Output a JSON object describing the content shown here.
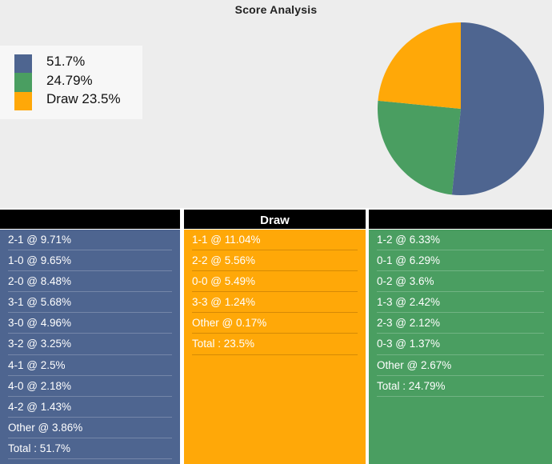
{
  "chart": {
    "title": "Score Analysis"
  },
  "legend": {
    "items": [
      {
        "label": "51.7%",
        "color": "#4e6590"
      },
      {
        "label": "24.79%",
        "color": "#4a9e61"
      },
      {
        "label": "Draw 23.5%",
        "color": "#ffa808"
      }
    ]
  },
  "tables": {
    "home": {
      "header": "",
      "rows": [
        "2-1 @ 9.71%",
        "1-0 @ 9.65%",
        "2-0 @ 8.48%",
        "3-1 @ 5.68%",
        "3-0 @ 4.96%",
        "3-2 @ 3.25%",
        "4-1 @ 2.5%",
        "4-0 @ 2.18%",
        "4-2 @ 1.43%",
        "Other @ 3.86%",
        "Total : 51.7%"
      ]
    },
    "draw": {
      "header": "Draw",
      "rows": [
        "1-1 @ 11.04%",
        "2-2 @ 5.56%",
        "0-0 @ 5.49%",
        "3-3 @ 1.24%",
        "Other @ 0.17%",
        "Total : 23.5%"
      ]
    },
    "away": {
      "header": "",
      "rows": [
        "1-2 @ 6.33%",
        "0-1 @ 6.29%",
        "0-2 @ 3.6%",
        "1-3 @ 2.42%",
        "2-3 @ 2.12%",
        "0-3 @ 1.37%",
        "Other @ 2.67%",
        "Total : 24.79%"
      ]
    }
  },
  "chart_data": {
    "type": "pie",
    "title": "Score Analysis",
    "labels": [
      "51.7%",
      "24.79%",
      "Draw 23.5%"
    ],
    "values": [
      51.7,
      24.79,
      23.5
    ],
    "colors": [
      "#4e6590",
      "#4a9e61",
      "#ffa808"
    ],
    "legend_position": "top-left",
    "start_angle_deg": 0,
    "direction": "clockwise",
    "grid": false
  }
}
